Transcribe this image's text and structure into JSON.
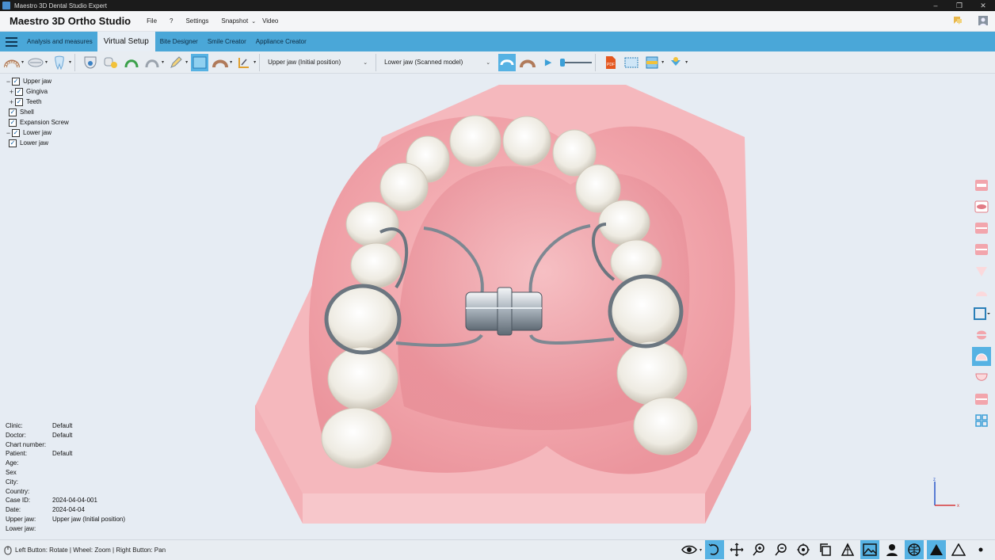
{
  "window": {
    "title": "Maestro 3D Dental Studio Expert",
    "controls": [
      "–",
      "❐",
      "✕"
    ]
  },
  "menubar": {
    "brand": "Maestro 3D Ortho Studio",
    "items": [
      "File",
      "?",
      "Settings",
      "Snapshot",
      "Video"
    ],
    "snapshot_caret": "⌄"
  },
  "tabs": {
    "items": [
      "Analysis and measures",
      "Virtual Setup",
      "Bite Designer",
      "Smile Creator",
      "Appliance Creator"
    ],
    "active": "Virtual Setup"
  },
  "toolbar": {
    "upper_jaw_select": "Upper jaw (Initial position)",
    "lower_jaw_select": "Lower jaw (Scanned model)",
    "pdf_label": "PDF",
    "play_icon": "▶",
    "slider_value": 0
  },
  "tree": {
    "upper_jaw": "Upper jaw",
    "gingiva": "Gingiva",
    "teeth": "Teeth",
    "shell": "Shell",
    "expansion_screw": "Expansion Screw",
    "lower_jaw": "Lower jaw",
    "lower_jaw_child": "Lower jaw",
    "expand_minus": "−",
    "expand_plus": "+",
    "check": "✓"
  },
  "patient_info": [
    {
      "label": "Clinic:",
      "value": "Default"
    },
    {
      "label": "Doctor:",
      "value": "Default"
    },
    {
      "label": "Chart number:",
      "value": ""
    },
    {
      "label": "Patient:",
      "value": "Default"
    },
    {
      "label": "Age:",
      "value": ""
    },
    {
      "label": "Sex",
      "value": ""
    },
    {
      "label": "City:",
      "value": ""
    },
    {
      "label": "Country:",
      "value": ""
    },
    {
      "label": "Case ID:",
      "value": "2024-04-04-001"
    },
    {
      "label": "Date:",
      "value": "2024-04-04"
    },
    {
      "label": "Upper jaw:",
      "value": "Upper jaw (Initial position)"
    },
    {
      "label": "Lower jaw:",
      "value": ""
    }
  ],
  "axes": {
    "x": "x",
    "z": "z"
  },
  "statusbar": {
    "hint": "Left Button: Rotate | Wheel: Zoom | Right Button: Pan"
  },
  "colors": {
    "accent": "#4aa7d8",
    "selected": "#56b2e3",
    "gum": "#f4a9ae",
    "gum_base": "#f7c2c6",
    "tooth": "#f2efe6",
    "metal": "#9aa4ad"
  }
}
